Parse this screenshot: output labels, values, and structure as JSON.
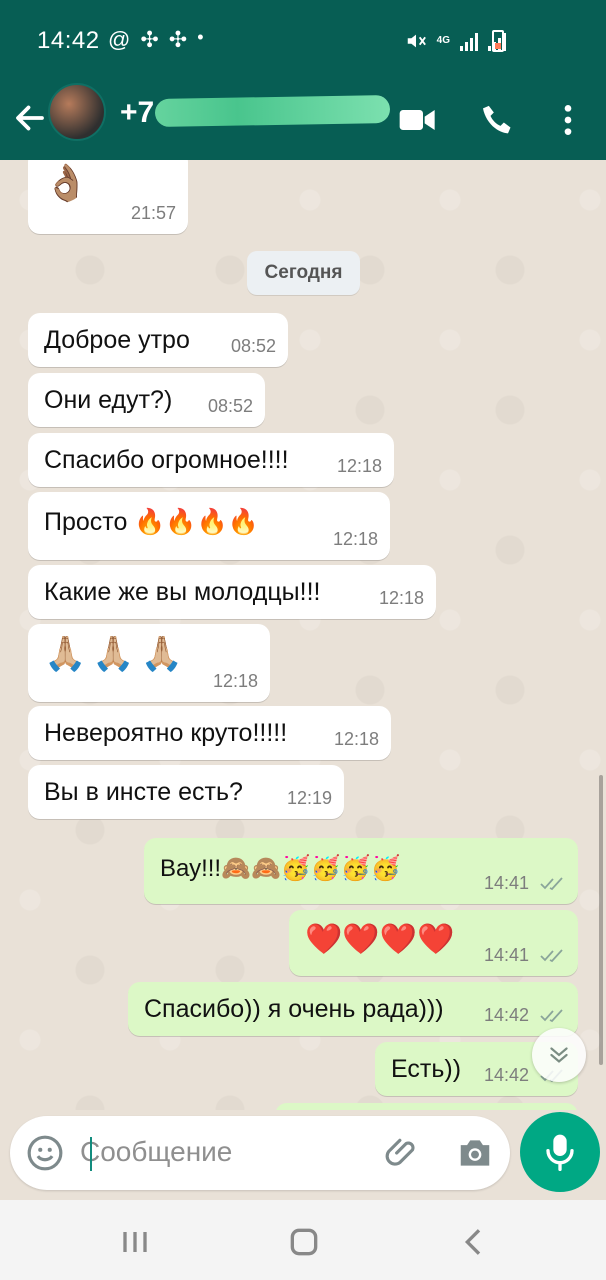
{
  "status_bar": {
    "time": "14:42",
    "network": "4G"
  },
  "header": {
    "contact_label": "+7"
  },
  "chat": {
    "date_separator": "Сегодня",
    "messages": [
      {
        "text": "👌🏽",
        "time": "21:57",
        "dir": "in"
      },
      {
        "text": "Доброе утро",
        "time": "08:52",
        "dir": "in"
      },
      {
        "text": "Они едут?)",
        "time": "08:52",
        "dir": "in"
      },
      {
        "text": "Спасибо огромное!!!!",
        "time": "12:18",
        "dir": "in"
      },
      {
        "text": "Просто 🔥🔥🔥🔥",
        "time": "12:18",
        "dir": "in"
      },
      {
        "text": "Какие же вы молодцы!!!",
        "time": "12:18",
        "dir": "in"
      },
      {
        "text": "🙏🏼🙏🏼🙏🏼",
        "time": "12:18",
        "dir": "in"
      },
      {
        "text": "Невероятно круто!!!!!",
        "time": "12:18",
        "dir": "in"
      },
      {
        "text": "Вы в инсте есть?",
        "time": "12:19",
        "dir": "in"
      },
      {
        "text": "Вау!!!🙈🙈🥳🥳🥳🥳",
        "time": "14:41",
        "dir": "out"
      },
      {
        "text": "❤️❤️❤️❤️",
        "time": "14:41",
        "dir": "out"
      },
      {
        "text": "Спасибо)) я очень рада)))",
        "time": "14:42",
        "dir": "out"
      },
      {
        "text": "Есть))",
        "time": "14:42",
        "dir": "out"
      }
    ]
  },
  "composer": {
    "placeholder": "Сообщение"
  },
  "colors": {
    "header": "#075e54",
    "outgoing": "#dcf8c6",
    "accent": "#00a884"
  }
}
